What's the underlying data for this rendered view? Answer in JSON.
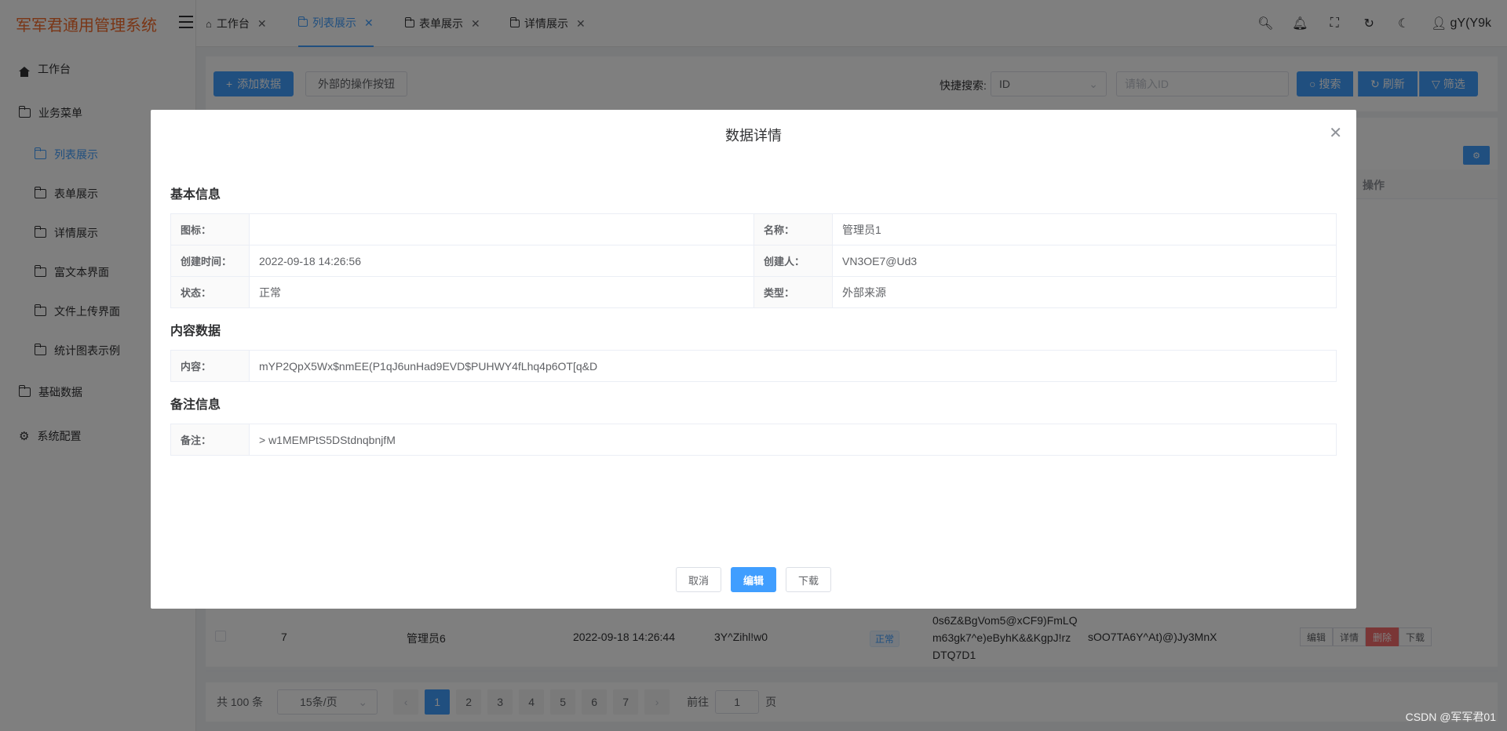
{
  "app": {
    "title": "军军君通用管理系统"
  },
  "sidebar": {
    "items": [
      {
        "label": "工作台",
        "type": "top"
      },
      {
        "label": "业务菜单",
        "type": "top"
      },
      {
        "label": "列表展示",
        "type": "sub",
        "active": true
      },
      {
        "label": "表单展示",
        "type": "sub"
      },
      {
        "label": "详情展示",
        "type": "sub"
      },
      {
        "label": "富文本界面",
        "type": "sub"
      },
      {
        "label": "文件上传界面",
        "type": "sub"
      },
      {
        "label": "统计图表示例",
        "type": "sub"
      },
      {
        "label": "基础数据",
        "type": "top"
      },
      {
        "label": "系统配置",
        "type": "top"
      }
    ]
  },
  "tabs": [
    {
      "label": "工作台",
      "icon": "home-icon"
    },
    {
      "label": "列表展示",
      "icon": "folder-icon",
      "active": true
    },
    {
      "label": "表单展示",
      "icon": "folder-icon"
    },
    {
      "label": "详情展示",
      "icon": "folder-icon"
    }
  ],
  "header": {
    "username": "gY(Y9k"
  },
  "toolbar": {
    "add_label": "添加数据",
    "external_label": "外部的操作按钮",
    "quick_search_label": "快捷搜索:",
    "search_field": "ID",
    "search_placeholder": "请输入ID",
    "search_btn": "搜索",
    "refresh_btn": "刷新",
    "filter_btn": "筛选"
  },
  "table": {
    "op_header": "操作",
    "row_actions": {
      "edit": "编辑",
      "detail": "详情",
      "delete": "删除",
      "download": "下载"
    },
    "visible_row": {
      "index": "7",
      "name": "管理员6",
      "time": "2022-09-18 14:26:44",
      "creator": "3Y^Zihl!w0",
      "status": "正常",
      "content": "0s6Z&BgVom5@xCF9)FmLQm63gk7^e)eByhK&&KgpJ!rzDTQ7D1",
      "remark": "sOO7TA6Y^At)@)Jy3MnX"
    }
  },
  "pagination": {
    "total": "共 100 条",
    "page_size": "15条/页",
    "pages": [
      "1",
      "2",
      "3",
      "4",
      "5",
      "6",
      "7"
    ],
    "current": "1",
    "goto_label": "前往",
    "goto_value": "1",
    "page_suffix": "页"
  },
  "dialog": {
    "title": "数据详情",
    "sections": {
      "basic": "基本信息",
      "content": "内容数据",
      "remark": "备注信息"
    },
    "fields": {
      "icon_label": "图标：",
      "icon_value": "",
      "name_label": "名称：",
      "name_value": "管理员1",
      "created_label": "创建时间：",
      "created_value": "2022-09-18 14:26:56",
      "creator_label": "创建人：",
      "creator_value": "VN3OE7@Ud3",
      "status_label": "状态：",
      "status_value": "正常",
      "type_label": "类型：",
      "type_value": "外部来源",
      "content_label": "内容：",
      "content_value": "mYP2QpX5Wx$nmEE(P1qJ6unHad9EVD$PUHWY4fLhq4p6OT[q&D",
      "remark_label": "备注：",
      "remark_value": "> w1MEMPtS5DStdnqbnjfM"
    },
    "buttons": {
      "cancel": "取消",
      "edit": "编辑",
      "download": "下载"
    }
  },
  "watermark": "CSDN @军军君01",
  "colors": {
    "primary": "#409eff",
    "danger": "#f56c6c",
    "logo": "#f56c2d"
  }
}
